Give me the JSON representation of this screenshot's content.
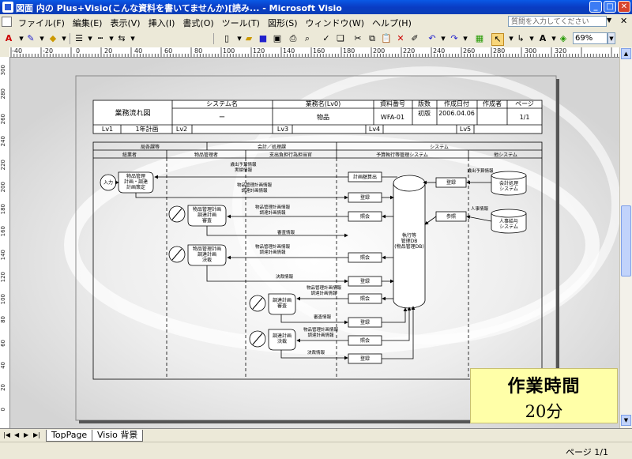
{
  "window": {
    "title": "図面 内の Plus+Visio(こんな資料を書いてませんか)[読み... - Microsoft Visio"
  },
  "menu": {
    "items": [
      "ファイル(F)",
      "編集(E)",
      "表示(V)",
      "挿入(I)",
      "書式(O)",
      "ツール(T)",
      "図形(S)",
      "ウィンドウ(W)",
      "ヘルプ(H)"
    ],
    "help_placeholder": "質問を入力してください"
  },
  "toolbar": {
    "zoom": "69%"
  },
  "ruler": {
    "h_labels": [
      "-40",
      "-20",
      "0",
      "20",
      "40",
      "60",
      "80",
      "100",
      "120",
      "140",
      "160",
      "180",
      "200",
      "220",
      "240",
      "260",
      "280",
      "300",
      "320"
    ],
    "v_labels": [
      "300",
      "280",
      "260",
      "240",
      "220",
      "200",
      "180",
      "160",
      "140",
      "120",
      "100",
      "80",
      "60",
      "40",
      "20",
      "0"
    ]
  },
  "diagram": {
    "header": {
      "title": "業務流れ図",
      "col_system": "システム名",
      "col_business": "業務名(Lv0)",
      "col_docno": "資料番号",
      "col_version": "版数",
      "col_date": "作成日付",
      "col_author": "作成者",
      "col_page": "ページ",
      "system_val": "ー",
      "business_val": "物品",
      "docno_val": "WFA-01",
      "version_val": "初版",
      "date_val": "2006.04.06",
      "page_val": "1/1",
      "lv1": "Lv1",
      "lv1_val": "1年計画",
      "lv2": "Lv2",
      "lv3": "Lv3",
      "lv4": "Lv4",
      "lv5": "Lv5"
    },
    "lanes": {
      "group1": "局各課等",
      "group2": "会計／処理課",
      "group3": "システム",
      "l1": "総業者",
      "l2": "物品管理者",
      "l3": "支出負担行為担当官",
      "l4": "予算執行等管理システム",
      "l5": "他システム"
    },
    "shapes": {
      "start": "入力",
      "doc1": [
        "物品管理",
        "計画・調達",
        "計画策定"
      ],
      "doc2": [
        "物品管理計画",
        "調達計画",
        "審査"
      ],
      "doc3": [
        "物品管理計画",
        "調達計画",
        "決裁"
      ],
      "doc4": [
        "調達計画",
        "審査"
      ],
      "doc5": [
        "調達計画",
        "決裁"
      ],
      "db": [
        "執行等",
        "管理DB",
        "(物品管理DB)"
      ],
      "acct": [
        "会計処理",
        "システム"
      ],
      "hr": [
        "人事給与",
        "システム"
      ]
    },
    "process": {
      "p1": "計画額算出",
      "p2": "登録",
      "p3": "照会",
      "p4": "照会",
      "p5": "登録",
      "p6": "照会",
      "p7": "登録",
      "p8": "照会",
      "p9": "登録",
      "p10": "登録",
      "p11": "参照"
    },
    "msgs": {
      "m1": [
        "歳出予算情報",
        "実績情報"
      ],
      "m2": [
        "物品管理計画情報",
        "調達計画情報"
      ],
      "m3": [
        "物品管理計画情報",
        "調達計画情報"
      ],
      "m4": "審査情報",
      "m5": [
        "物品管理計画情報",
        "調達計画情報"
      ],
      "m6": "決裁情報",
      "m7": [
        "物品管理計画情報",
        "調達計画情報"
      ],
      "m8": "審査情報",
      "m9": [
        "物品管理計画情報",
        "調達計画情報"
      ],
      "m10": "決裁情報",
      "m11": "歳出予算情報",
      "m12": "人事情報"
    }
  },
  "overlay": {
    "line1": "作業時間",
    "line2": "20分"
  },
  "tabs": {
    "t1": "TopPage",
    "t2": "Visio 背景"
  },
  "status": {
    "page": "ページ 1/1"
  }
}
